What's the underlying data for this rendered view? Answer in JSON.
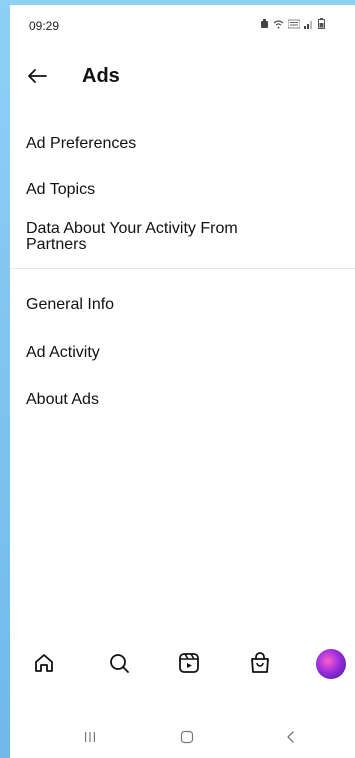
{
  "status": {
    "time": "09:29"
  },
  "header": {
    "title": "Ads",
    "back_icon": "arrow-left-icon"
  },
  "menu": {
    "group1": [
      {
        "label": "Ad Preferences"
      },
      {
        "label": "Ad Topics"
      },
      {
        "label_line1": "Data About Your Activity From",
        "label_line2": "Partners"
      }
    ],
    "group2": [
      {
        "label": "General Info"
      },
      {
        "label": "Ad Activity"
      },
      {
        "label": "About Ads"
      }
    ]
  },
  "tabbar": {
    "icons": [
      "home-icon",
      "search-icon",
      "reels-icon",
      "shop-icon",
      "profile-avatar"
    ]
  },
  "navbar": {
    "icons": [
      "recent-apps-icon",
      "home-button-icon",
      "back-nav-icon"
    ]
  },
  "colors": {
    "frame": "#7ec3ee",
    "text": "#111111",
    "divider": "#e6e6e6"
  }
}
